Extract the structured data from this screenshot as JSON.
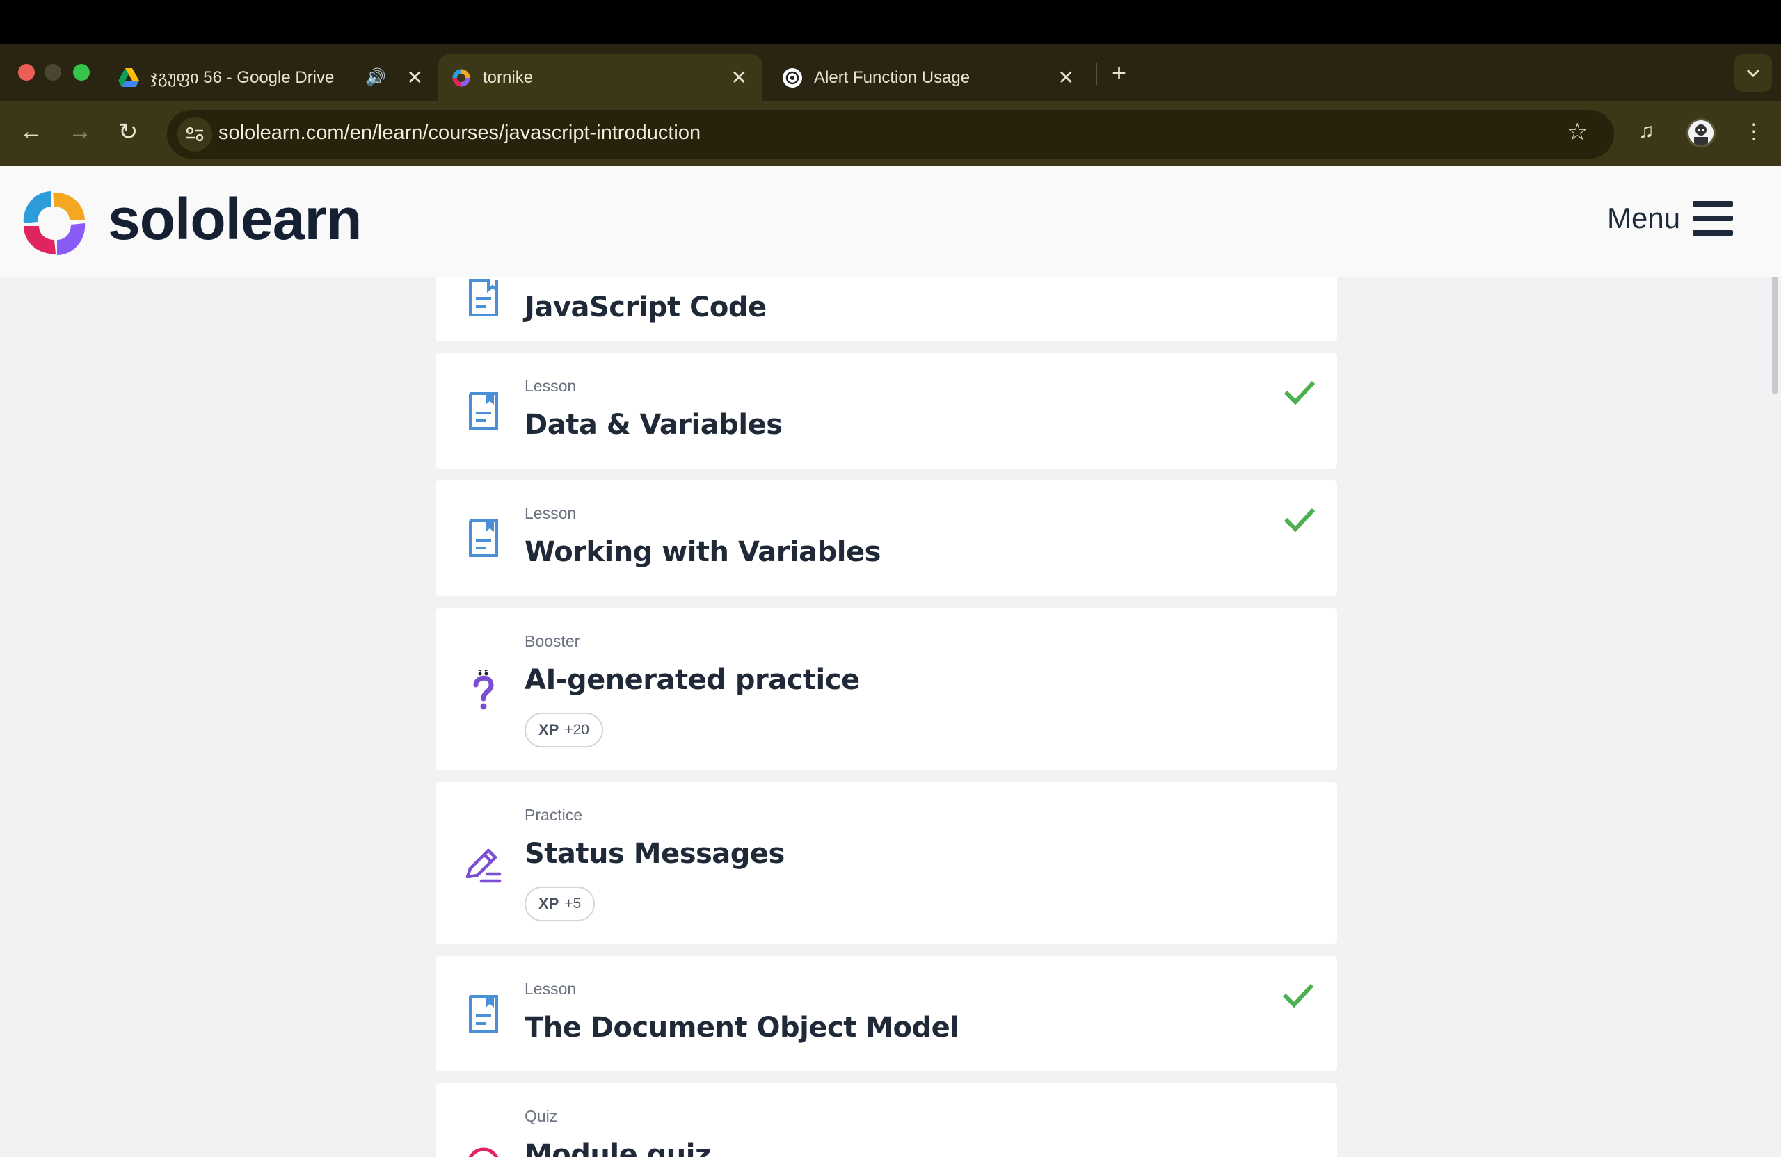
{
  "browser": {
    "tabs": [
      {
        "title": "ჯგუფი 56 - Google Drive",
        "favicon": "google-drive-icon",
        "audio": "speaker-icon"
      },
      {
        "title": "tornike",
        "favicon": "sololearn-icon",
        "active": true
      },
      {
        "title": "Alert Function Usage",
        "favicon": "chatgpt-icon"
      }
    ],
    "url": "sololearn.com/en/learn/courses/javascript-introduction"
  },
  "header": {
    "logo_text": "sololearn",
    "menu_label": "Menu"
  },
  "items": [
    {
      "type": "",
      "title": "JavaScript Code",
      "icon": "lesson-icon",
      "completed": false
    },
    {
      "type": "Lesson",
      "title": "Data & Variables",
      "icon": "lesson-icon",
      "completed": true
    },
    {
      "type": "Lesson",
      "title": "Working with Variables",
      "icon": "lesson-icon",
      "completed": true
    },
    {
      "type": "Booster",
      "title": "AI-generated practice",
      "icon": "booster-question-icon",
      "xp_label": "XP",
      "xp_value": "+20"
    },
    {
      "type": "Practice",
      "title": "Status Messages",
      "icon": "practice-pencil-icon",
      "xp_label": "XP",
      "xp_value": "+5"
    },
    {
      "type": "Lesson",
      "title": "The Document Object Model",
      "icon": "lesson-icon",
      "completed": true
    },
    {
      "type": "Quiz",
      "title": "Module quiz",
      "icon": "quiz-icon"
    }
  ],
  "colors": {
    "lesson_icon": "#4a90d9",
    "check": "#4caf50",
    "booster": "#7b4fd1",
    "quiz": "#e0245e"
  }
}
